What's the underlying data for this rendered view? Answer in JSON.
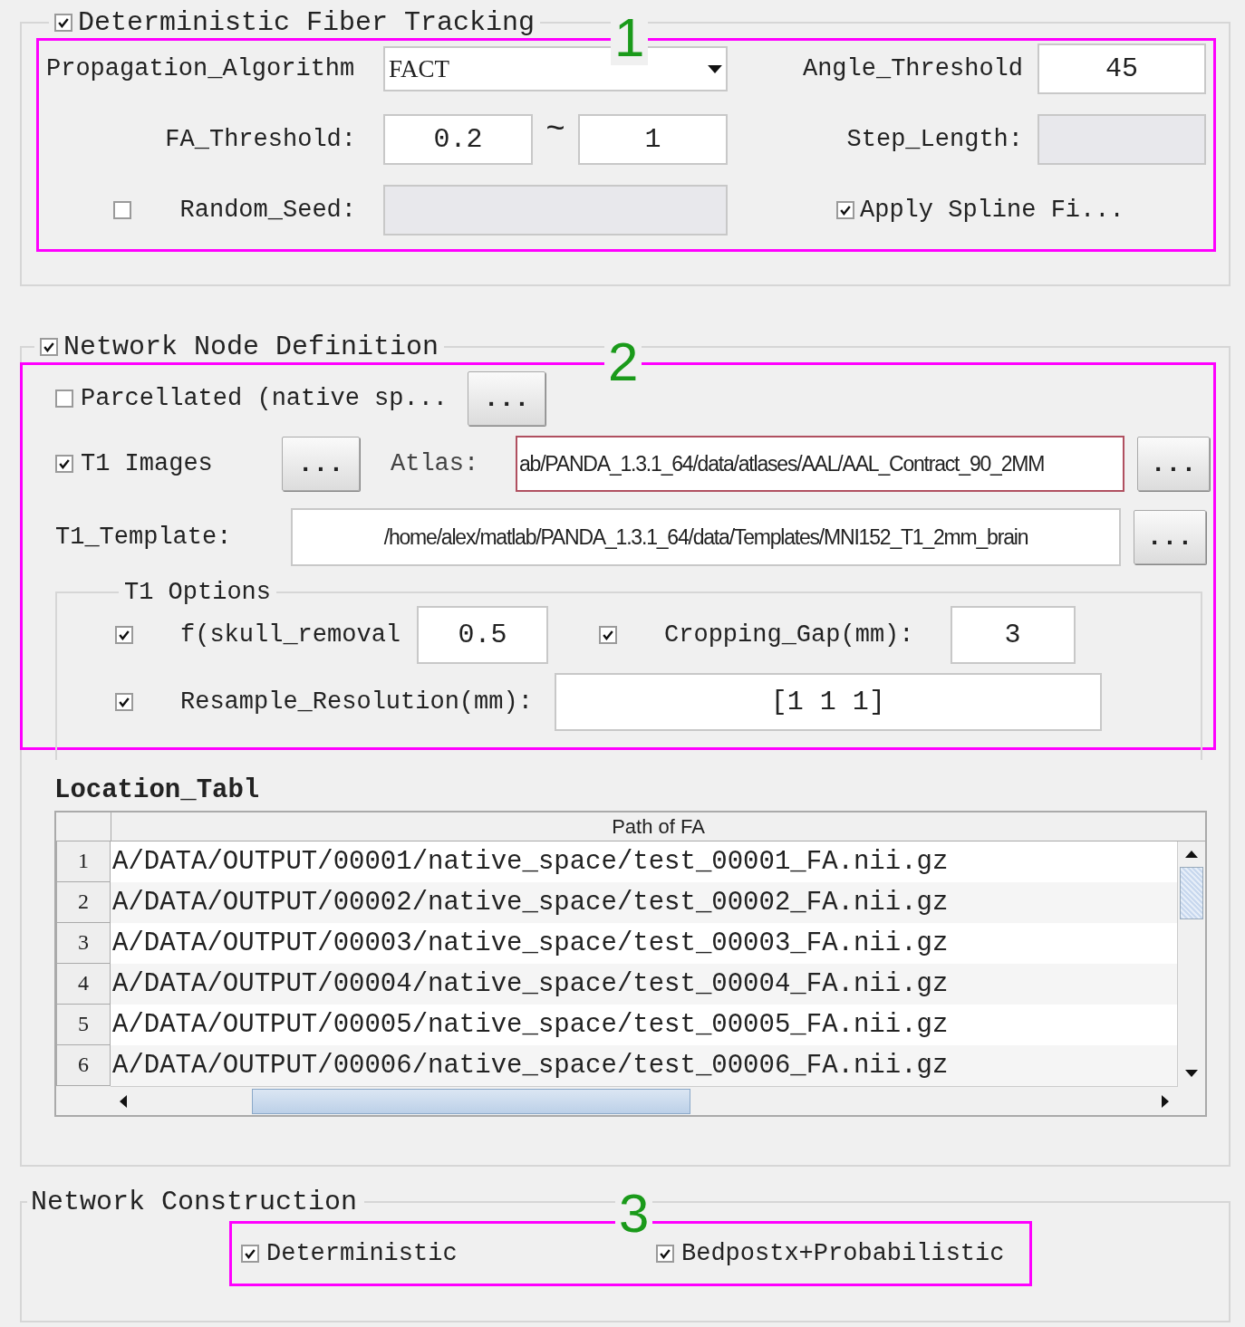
{
  "fiber_tracking": {
    "title": "Deterministic Fiber Tracking",
    "checked": true,
    "annotation": "1",
    "propagation_algorithm": {
      "label": "Propagation_Algorithm",
      "value": "FACT"
    },
    "angle_threshold": {
      "label": "Angle_Threshold",
      "value": "45"
    },
    "fa_threshold": {
      "label": "FA_Threshold:",
      "min": "0.2",
      "separator": "~",
      "max": "1"
    },
    "step_length": {
      "label": "Step_Length:",
      "disabled": true
    },
    "random_seed": {
      "label": "Random_Seed:",
      "checked": false,
      "disabled": true
    },
    "apply_spline": {
      "label": "Apply Spline Fi...",
      "checked": true
    }
  },
  "node_definition": {
    "title": "Network Node Definition",
    "checked": true,
    "annotation": "2",
    "parcellated": {
      "label": "Parcellated (native sp...",
      "checked": false,
      "button": "..."
    },
    "t1_images": {
      "label": "T1 Images",
      "checked": true,
      "button": "..."
    },
    "atlas": {
      "label": "Atlas:",
      "value": "ab/PANDA_1.3.1_64/data/atlases/AAL/AAL_Contract_90_2MM",
      "focused": true,
      "button": "..."
    },
    "t1_template": {
      "label": "T1_Template:",
      "value": "/home/alex/matlab/PANDA_1.3.1_64/data/Templates/MNI152_T1_2mm_brain",
      "button": "..."
    },
    "t1_options": {
      "title": "T1 Options",
      "skull_removal": {
        "label": "f(skull_removal",
        "checked": true,
        "value": "0.5"
      },
      "cropping_gap": {
        "label": "Cropping_Gap(mm):",
        "checked": true,
        "value": "3"
      },
      "resample_resolution": {
        "label": "Resample_Resolution(mm):",
        "checked": true,
        "value": "[1 1 1]"
      }
    },
    "location_table": {
      "title": "Location_Tabl",
      "columns": [
        "Path of FA"
      ],
      "rows": [
        {
          "index": "1",
          "path": "A/DATA/OUTPUT/00001/native_space/test_00001_FA.nii.gz"
        },
        {
          "index": "2",
          "path": "A/DATA/OUTPUT/00002/native_space/test_00002_FA.nii.gz"
        },
        {
          "index": "3",
          "path": "A/DATA/OUTPUT/00003/native_space/test_00003_FA.nii.gz"
        },
        {
          "index": "4",
          "path": "A/DATA/OUTPUT/00004/native_space/test_00004_FA.nii.gz"
        },
        {
          "index": "5",
          "path": "A/DATA/OUTPUT/00005/native_space/test_00005_FA.nii.gz"
        },
        {
          "index": "6",
          "path": "A/DATA/OUTPUT/00006/native_space/test_00006_FA.nii.gz"
        }
      ]
    }
  },
  "network_construction": {
    "title": "Network Construction",
    "annotation": "3",
    "options": [
      {
        "label": "Deterministic",
        "checked": true
      },
      {
        "label": "Bedpostx+Probabilistic",
        "checked": true
      }
    ]
  }
}
